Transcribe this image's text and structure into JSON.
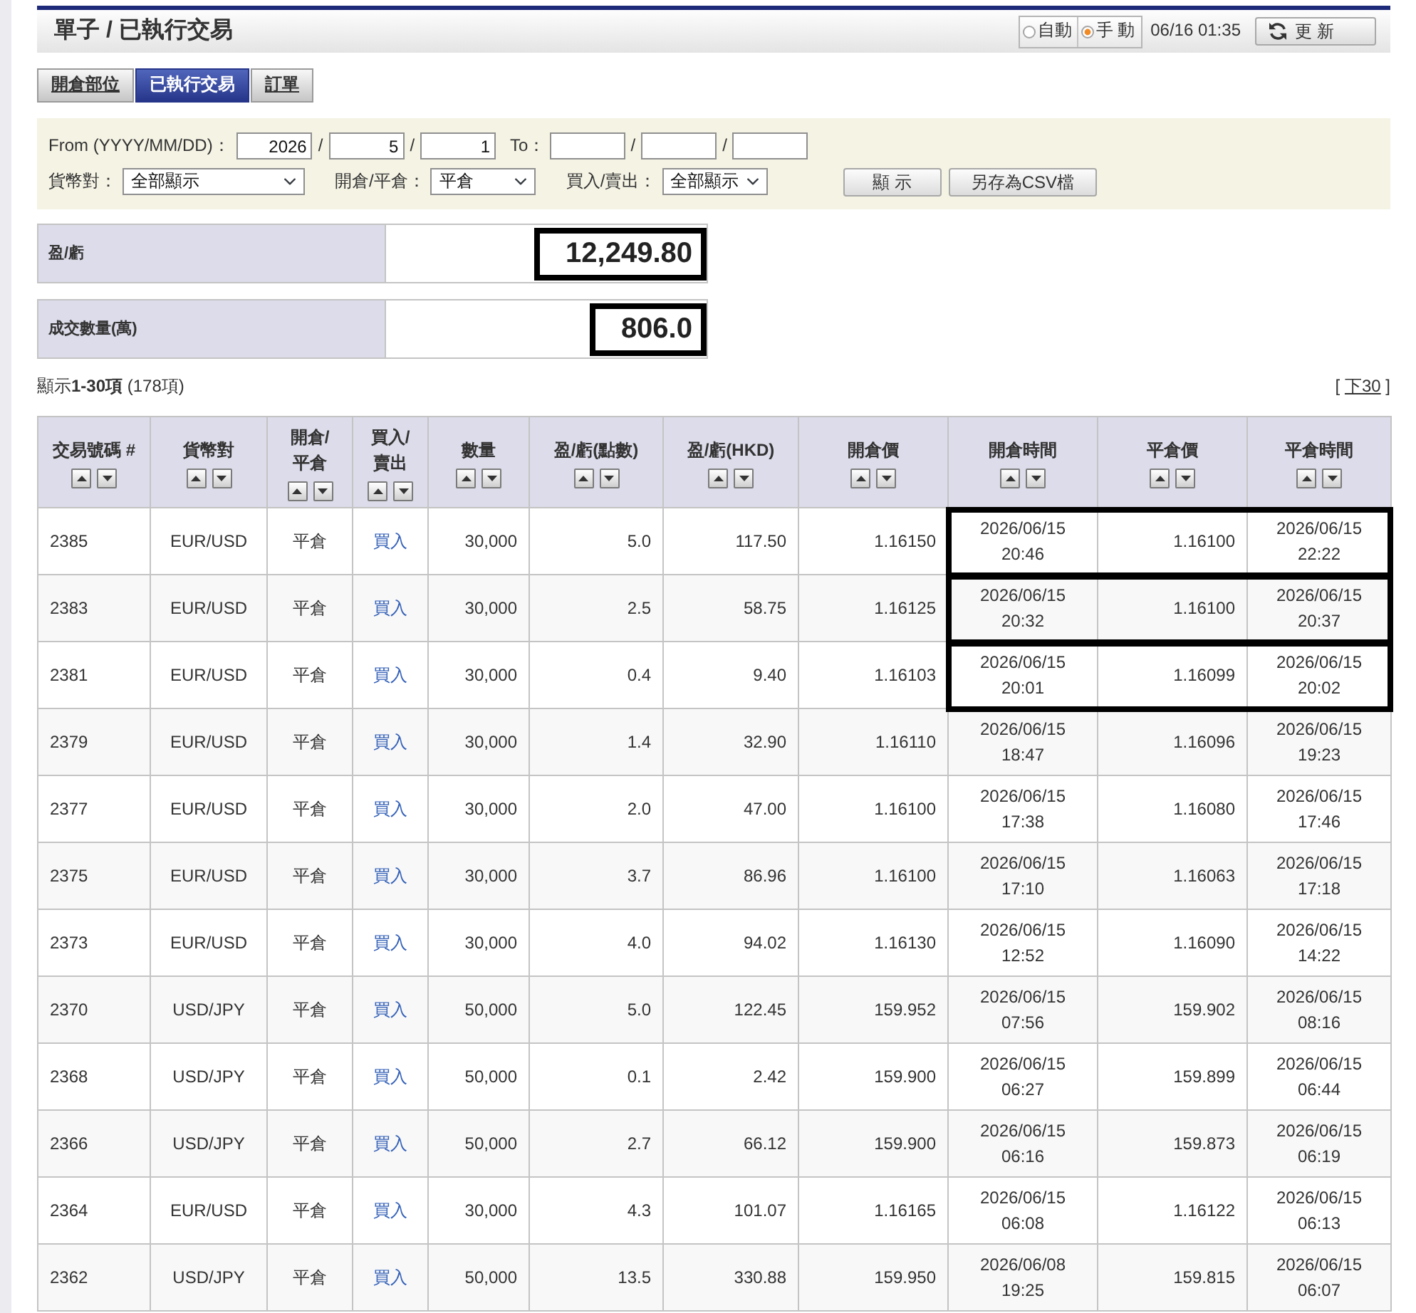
{
  "page_header": {
    "title": "單子 / 已執行交易",
    "refresh_mode": [
      {
        "label": "自動",
        "selected": false
      },
      {
        "label": "手 動",
        "selected": true
      }
    ],
    "timestamp": "06/16 01:35",
    "refresh_button": "更 新"
  },
  "tabs": [
    {
      "label": "開倉部位",
      "selected": false
    },
    {
      "label": "已執行交易",
      "selected": true
    },
    {
      "label": "訂單",
      "selected": false
    }
  ],
  "filter": {
    "from_date": {
      "label": "From (YYYY/MM/DD)：",
      "values": [
        "2026",
        "5",
        "1"
      ],
      "separators": [
        "/",
        "/"
      ]
    },
    "to_date": {
      "label": "To：",
      "separators": [
        "/",
        "/"
      ]
    },
    "selects": [
      {
        "label": "貨幣對：",
        "value": "全部顯示"
      },
      {
        "label": "開倉/平倉：",
        "value": "平倉"
      },
      {
        "label": "買入/賣出：",
        "value": "全部顯示"
      }
    ],
    "buttons": [
      "顯 示",
      "另存為CSV檔"
    ]
  },
  "summary": [
    {
      "label": "盈/虧",
      "value": "12,249.80",
      "highlighted": true
    },
    {
      "label": "成交數量(萬)",
      "value": "806.0",
      "highlighted": true
    }
  ],
  "listing": {
    "range_text": "顯示**1-30項** (178項)",
    "pager": {
      "open": "[",
      "link": "下30",
      "close": "]"
    }
  },
  "table": {
    "columns": [
      "交易號碼 #",
      "貨幣對",
      "開倉/平倉",
      "買入/賣出",
      "數量",
      "盈/虧(點數)",
      "盈/虧(HKD)",
      "開倉價",
      "開倉時間",
      "平倉價",
      "平倉時間"
    ],
    "rows": [
      {
        "trade_no": "2385",
        "pair": "EUR/USD",
        "open_close": "平倉",
        "side": "買入",
        "quantity": "30,000",
        "pips": "5.0",
        "pnl_hkd": "117.50",
        "open_price": "1.16150",
        "open_time": "2026/06/15 20:46",
        "close_price": "1.16100",
        "close_time": "2026/06/15 22:22",
        "highlighted": true
      },
      {
        "trade_no": "2383",
        "pair": "EUR/USD",
        "open_close": "平倉",
        "side": "買入",
        "quantity": "30,000",
        "pips": "2.5",
        "pnl_hkd": "58.75",
        "open_price": "1.16125",
        "open_time": "2026/06/15 20:32",
        "close_price": "1.16100",
        "close_time": "2026/06/15 20:37",
        "highlighted": true
      },
      {
        "trade_no": "2381",
        "pair": "EUR/USD",
        "open_close": "平倉",
        "side": "買入",
        "quantity": "30,000",
        "pips": "0.4",
        "pnl_hkd": "9.40",
        "open_price": "1.16103",
        "open_time": "2026/06/15 20:01",
        "close_price": "1.16099",
        "close_time": "2026/06/15 20:02",
        "highlighted": true
      },
      {
        "trade_no": "2379",
        "pair": "EUR/USD",
        "open_close": "平倉",
        "side": "買入",
        "quantity": "30,000",
        "pips": "1.4",
        "pnl_hkd": "32.90",
        "open_price": "1.16110",
        "open_time": "2026/06/15 18:47",
        "close_price": "1.16096",
        "close_time": "2026/06/15 19:23",
        "highlighted": false
      },
      {
        "trade_no": "2377",
        "pair": "EUR/USD",
        "open_close": "平倉",
        "side": "買入",
        "quantity": "30,000",
        "pips": "2.0",
        "pnl_hkd": "47.00",
        "open_price": "1.16100",
        "open_time": "2026/06/15 17:38",
        "close_price": "1.16080",
        "close_time": "2026/06/15 17:46",
        "highlighted": false
      },
      {
        "trade_no": "2375",
        "pair": "EUR/USD",
        "open_close": "平倉",
        "side": "買入",
        "quantity": "30,000",
        "pips": "3.7",
        "pnl_hkd": "86.96",
        "open_price": "1.16100",
        "open_time": "2026/06/15 17:10",
        "close_price": "1.16063",
        "close_time": "2026/06/15 17:18",
        "highlighted": false
      },
      {
        "trade_no": "2373",
        "pair": "EUR/USD",
        "open_close": "平倉",
        "side": "買入",
        "quantity": "30,000",
        "pips": "4.0",
        "pnl_hkd": "94.02",
        "open_price": "1.16130",
        "open_time": "2026/06/15 12:52",
        "close_price": "1.16090",
        "close_time": "2026/06/15 14:22",
        "highlighted": false
      },
      {
        "trade_no": "2370",
        "pair": "USD/JPY",
        "open_close": "平倉",
        "side": "買入",
        "quantity": "50,000",
        "pips": "5.0",
        "pnl_hkd": "122.45",
        "open_price": "159.952",
        "open_time": "2026/06/15 07:56",
        "close_price": "159.902",
        "close_time": "2026/06/15 08:16",
        "highlighted": false
      },
      {
        "trade_no": "2368",
        "pair": "USD/JPY",
        "open_close": "平倉",
        "side": "買入",
        "quantity": "50,000",
        "pips": "0.1",
        "pnl_hkd": "2.42",
        "open_price": "159.900",
        "open_time": "2026/06/15 06:27",
        "close_price": "159.899",
        "close_time": "2026/06/15 06:44",
        "highlighted": false
      },
      {
        "trade_no": "2366",
        "pair": "USD/JPY",
        "open_close": "平倉",
        "side": "買入",
        "quantity": "50,000",
        "pips": "2.7",
        "pnl_hkd": "66.12",
        "open_price": "159.900",
        "open_time": "2026/06/15 06:16",
        "close_price": "159.873",
        "close_time": "2026/06/15 06:19",
        "highlighted": false
      },
      {
        "trade_no": "2364",
        "pair": "EUR/USD",
        "open_close": "平倉",
        "side": "買入",
        "quantity": "30,000",
        "pips": "4.3",
        "pnl_hkd": "101.07",
        "open_price": "1.16165",
        "open_time": "2026/06/15 06:08",
        "close_price": "1.16122",
        "close_time": "2026/06/15 06:13",
        "highlighted": false
      },
      {
        "trade_no": "2362",
        "pair": "USD/JPY",
        "open_close": "平倉",
        "side": "買入",
        "quantity": "50,000",
        "pips": "13.5",
        "pnl_hkd": "330.88",
        "open_price": "159.950",
        "open_time": "2026/06/08 19:25",
        "close_price": "159.815",
        "close_time": "2026/06/15 06:07",
        "highlighted": false
      }
    ]
  }
}
